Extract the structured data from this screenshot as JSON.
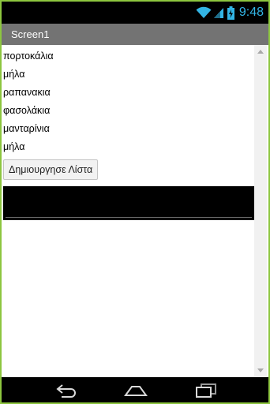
{
  "status_bar": {
    "time": "9:48",
    "icons": [
      "wifi-icon",
      "signal-icon",
      "battery-icon"
    ],
    "time_color": "#33b5e5"
  },
  "title_bar": {
    "title": "Screen1",
    "background": "#737373"
  },
  "list": {
    "items": [
      "πορτοκάλια",
      "μήλα",
      "ραπανακια",
      "φασολάκια",
      "μανταρίνια",
      "μήλα"
    ]
  },
  "button": {
    "label": "Δημιουργησε Λίστα"
  },
  "nav_bar": {
    "icons": [
      "back-icon",
      "home-icon",
      "recents-icon"
    ]
  },
  "colors": {
    "frame_border": "#8dc63f",
    "status_bar": "#000000"
  }
}
